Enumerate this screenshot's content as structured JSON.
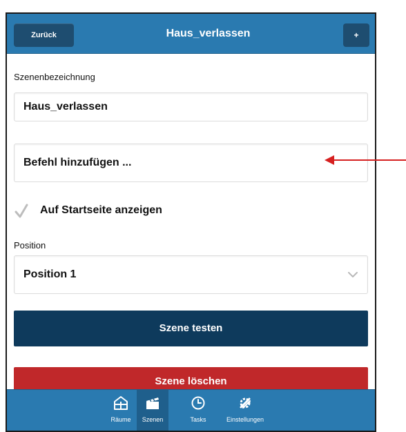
{
  "header": {
    "back_label": "Zurück",
    "title": "Haus_verlassen",
    "add_label": "+"
  },
  "form": {
    "name_label": "Szenenbezeichnung",
    "name_value": "Haus_verlassen",
    "add_command_label": "Befehl hinzufügen ...",
    "show_on_start_label": "Auf Startseite anzeigen",
    "show_on_start_checked": true,
    "position_label": "Position",
    "position_value": "Position 1"
  },
  "buttons": {
    "test_label": "Szene testen",
    "delete_label": "Szene löschen"
  },
  "bottom_nav": {
    "items": [
      {
        "label": "Räume",
        "icon": "rooms-icon",
        "active": false
      },
      {
        "label": "Szenen",
        "icon": "clapperboard-icon",
        "active": true
      },
      {
        "label": "Tasks",
        "icon": "clock-icon",
        "active": false
      },
      {
        "label": "Einstellungen",
        "icon": "settings-icon",
        "active": false
      }
    ]
  },
  "colors": {
    "header_blue": "#2a7ab0",
    "button_dark": "#1e4d70",
    "test_button": "#0e3a5c",
    "delete_button": "#c0282a",
    "annotation_arrow": "#d62020"
  }
}
